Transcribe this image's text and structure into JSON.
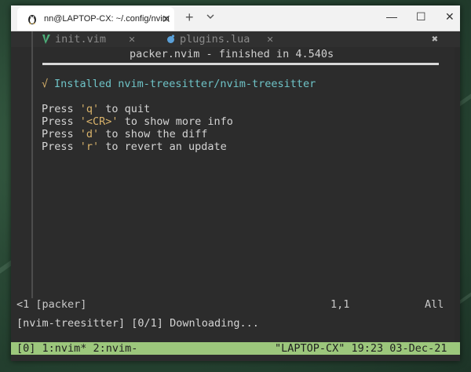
{
  "window": {
    "tab_title": "nn@LAPTOP-CX: ~/.config/nvim",
    "tab_close": "✕",
    "new_tab": "+",
    "minimize": "—",
    "maximize": "☐",
    "close": "✕"
  },
  "buffers": [
    {
      "name": "init.vim",
      "close": "✕",
      "icon": "vim-icon"
    },
    {
      "name": "plugins.lua",
      "close": "✕",
      "icon": "lua-icon"
    }
  ],
  "buffer_close_all": "✖",
  "packer": {
    "title": "packer.nvim - finished in 4.540s",
    "check": "√",
    "installed": "Installed nvim-treesitter/nvim-treesitter",
    "help": [
      {
        "pre": "Press ",
        "key": "'q'",
        "post": " to quit"
      },
      {
        "pre": "Press ",
        "key": "'<CR>'",
        "post": " to show more info"
      },
      {
        "pre": "Press ",
        "key": "'d'",
        "post": " to show the diff"
      },
      {
        "pre": "Press ",
        "key": "'r'",
        "post": " to revert an update"
      }
    ]
  },
  "statusline": {
    "left": "<1 [packer]",
    "position": "1,1",
    "scroll": "All"
  },
  "message": "[nvim-treesitter] [0/1] Downloading...",
  "tmux": {
    "left": "[0] 1:nvim* 2:nvim-",
    "right": "\"LAPTOP-CX\" 19:23 03-Dec-21"
  },
  "colors": {
    "accent_green": "#9cc77c",
    "cyan": "#6fc4c8",
    "yellow": "#d9b36b"
  }
}
